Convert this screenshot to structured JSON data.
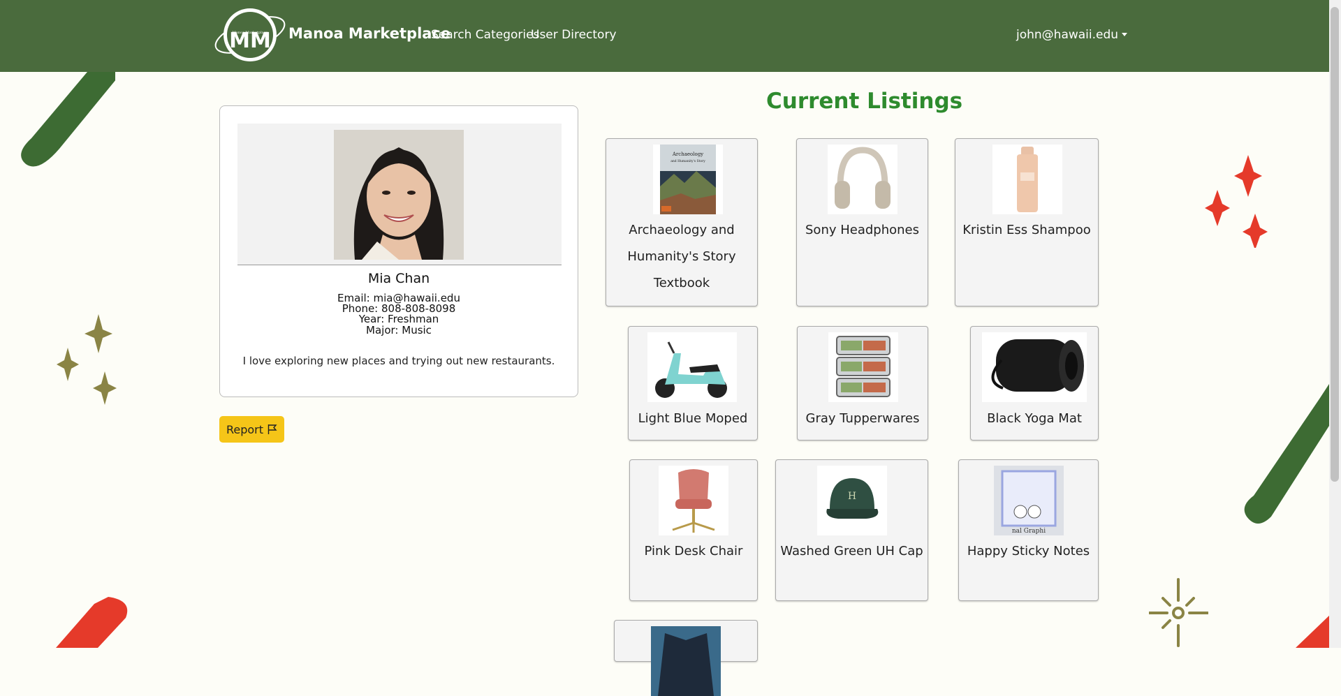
{
  "navbar": {
    "brand": "Manoa Marketplace",
    "logo_text": "Manoa Marketplace",
    "links": [
      "Search Categories",
      "User Directory"
    ],
    "user": "john@hawaii.edu"
  },
  "profile": {
    "name": "Mia Chan",
    "email": "Email: mia@hawaii.edu",
    "phone": "Phone: 808-808-8098",
    "year": "Year: Freshman",
    "major": "Major: Music",
    "bio": "I love exploring new places and trying out new restaurants."
  },
  "report_button": {
    "label": "Report",
    "icon": "flag-icon"
  },
  "listings": {
    "title": "Current Listings",
    "items": [
      "Archaeology and Humanity's Story Textbook",
      "Sony Headphones",
      "Kristin Ess Shampoo",
      "Light Blue Moped",
      "Gray Tupperwares",
      "Black Yoga Mat",
      "Pink Desk Chair",
      "Washed Green UH Cap",
      "Happy Sticky Notes"
    ]
  },
  "colors": {
    "navbar": "#4a6b3d",
    "title": "#2e8b2e",
    "report": "#f5c518"
  }
}
